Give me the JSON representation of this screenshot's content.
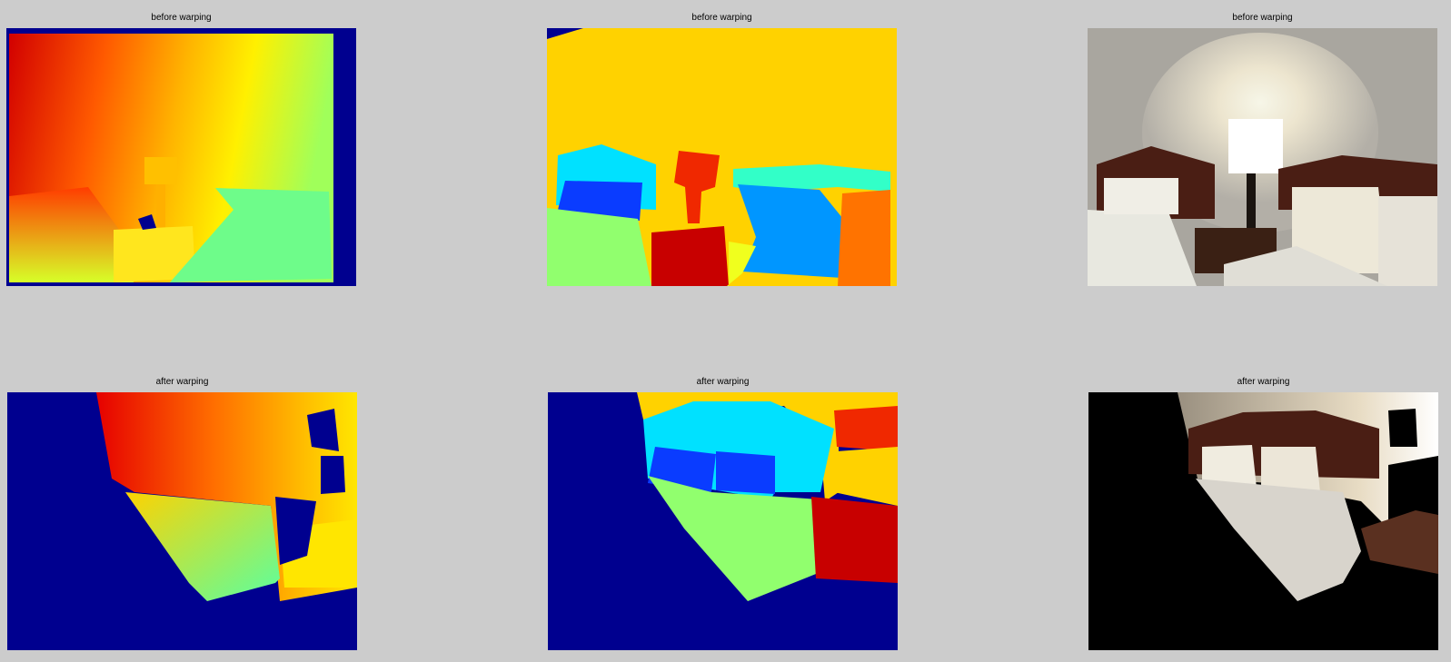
{
  "panels": [
    {
      "title": "before warping",
      "kind": "depth-map"
    },
    {
      "title": "before warping",
      "kind": "segmentation-map"
    },
    {
      "title": "before warping",
      "kind": "rgb-photo"
    },
    {
      "title": "after warping",
      "kind": "depth-map"
    },
    {
      "title": "after warping",
      "kind": "segmentation-map"
    },
    {
      "title": "after warping",
      "kind": "rgb-photo"
    }
  ],
  "colors": {
    "background": "#cccccc",
    "invalid_navy": "#00008f",
    "seg_wall": "#ffd200",
    "seg_headboard": "#00e1ff",
    "seg_pillow": "#0a3cff",
    "seg_bed": "#91ff6e",
    "seg_lamp": "#f02800",
    "seg_table": "#c80000",
    "seg_cyan2": "#32ffc8",
    "seg_blue2": "#0096ff",
    "seg_orange": "#ff7300"
  }
}
